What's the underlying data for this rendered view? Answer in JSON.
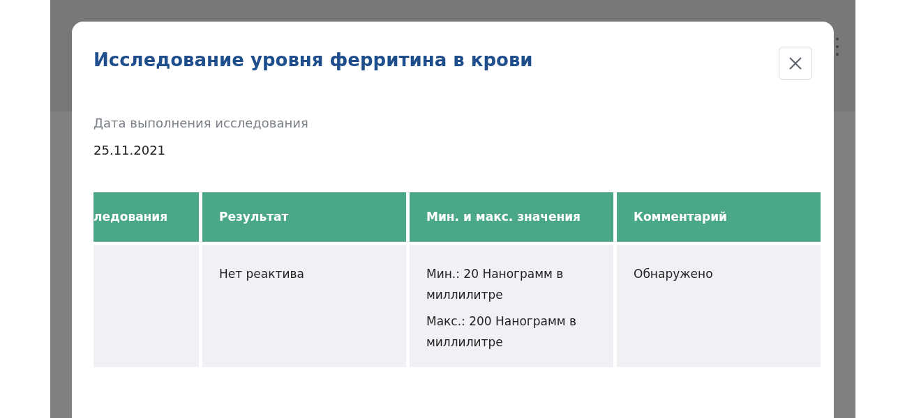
{
  "modal": {
    "title": "Исследование уровня ферритина в крови",
    "date_label": "Дата выполнения исследования",
    "date": "25.11.2021"
  },
  "table": {
    "columns": [
      "ледования",
      "Результат",
      "Мин. и макс. значения",
      "Комментарий"
    ],
    "rows": [
      {
        "cells": [
          [],
          [
            "Нет реактива"
          ],
          [
            "Мин.: 20 Нанограмм в миллилитре",
            "Макс.: 200 Нанограмм в миллилитре"
          ],
          [
            "Обнаружено"
          ]
        ]
      }
    ]
  }
}
